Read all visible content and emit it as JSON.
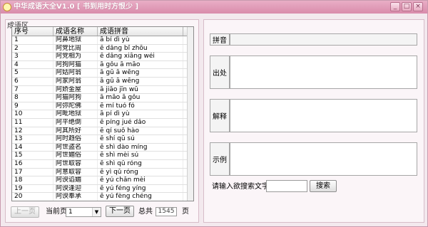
{
  "window": {
    "title": "中华成语大全V1.0 [ 书到用时方恨少 ]",
    "min_glyph": "_",
    "max_glyph": "□",
    "close_glyph": "×"
  },
  "left_panel": {
    "group_label": "成语区",
    "columns": [
      "序号",
      "成语名称",
      "成语拼音"
    ],
    "rows": [
      [
        "1",
        "阿鼻地狱",
        "ā bí dì yù"
      ],
      [
        "2",
        "阿党比周",
        "ē dǎng bǐ zhōu"
      ],
      [
        "3",
        "阿党相为",
        "ē dǎng xiāng wéi"
      ],
      [
        "4",
        "阿狗阿猫",
        "ā gǒu ā māo"
      ],
      [
        "5",
        "阿姑阿翁",
        "ā gū ā wēng"
      ],
      [
        "6",
        "阿家阿翁",
        "ā gū ā wēng"
      ],
      [
        "7",
        "阿娇金屋",
        "ā jiāo jīn wū"
      ],
      [
        "8",
        "阿猫阿狗",
        "ā māo ā gǒu"
      ],
      [
        "9",
        "阿弥陀佛",
        "ē mí tuó fó"
      ],
      [
        "10",
        "阿毗地狱",
        "ā pí dì yù"
      ],
      [
        "11",
        "阿平绝倒",
        "ē píng jué dǎo"
      ],
      [
        "12",
        "阿其所好",
        "ē qí suǒ hào"
      ],
      [
        "13",
        "阿时趋俗",
        "ē shí qū sú"
      ],
      [
        "14",
        "阿世盗名",
        "ē shì dào míng"
      ],
      [
        "15",
        "阿世媚俗",
        "ē shì mèi sú"
      ],
      [
        "16",
        "阿世取容",
        "ē shì qǔ róng"
      ],
      [
        "17",
        "阿意取容",
        "ē yì qǔ róng"
      ],
      [
        "18",
        "阿谀谄媚",
        "ē yú chǎn mèi"
      ],
      [
        "19",
        "阿谀逢迎",
        "ē yú féng yíng"
      ],
      [
        "20",
        "阿谀奉承",
        "ē yú fèng chéng"
      ]
    ],
    "prev_button": "上一页",
    "current_page_label": "当前页",
    "current_page_value": "1",
    "next_button": "下一页",
    "total_label": "总共",
    "total_value": "1545",
    "page_unit": "页"
  },
  "right_panel": {
    "pinyin_label": "拼音",
    "source_label": "出处",
    "explain_label": "解释",
    "example_label": "示例",
    "search_label": "请输入欲搜索文字:",
    "search_value": "",
    "search_button": "搜索"
  },
  "colors": {
    "title_bar": "#d98bab",
    "window_bg": "#f3e9ee",
    "panel_bg": "#fbf5f8"
  }
}
